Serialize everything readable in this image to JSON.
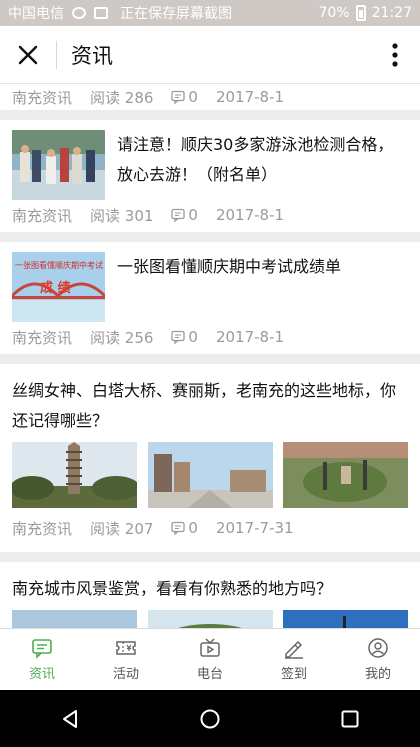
{
  "status_bar": {
    "carrier": "中国电信",
    "notice": "正在保存屏幕截图",
    "battery": "70%",
    "time": "21:27"
  },
  "header": {
    "title": "资讯"
  },
  "articles": [
    {
      "source": "南充资讯",
      "reads": "阅读 286",
      "comments": "0",
      "date": "2017-8-1"
    },
    {
      "title": "请注意！顺庆30多家游泳池检测合格，放心去游！（附名单）",
      "source": "南充资讯",
      "reads": "阅读 301",
      "comments": "0",
      "date": "2017-8-1"
    },
    {
      "title": "一张图看懂顺庆期中考试成绩单",
      "source": "南充资讯",
      "reads": "阅读 256",
      "comments": "0",
      "date": "2017-8-1",
      "thumb_caption": "一张图看懂顺庆期中考试",
      "thumb_word": "成 绩"
    },
    {
      "title": "丝绸女神、白塔大桥、赛丽斯，老南充的这些地标，你还记得哪些？",
      "source": "南充资讯",
      "reads": "阅读 207",
      "comments": "0",
      "date": "2017-7-31"
    },
    {
      "title": "南充城市风景鉴赏，看看有你熟悉的地方吗？"
    }
  ],
  "tabs": [
    {
      "label": "资讯",
      "icon": "news-icon",
      "active": true
    },
    {
      "label": "活动",
      "icon": "ticket-icon",
      "active": false
    },
    {
      "label": "电台",
      "icon": "radio-icon",
      "active": false
    },
    {
      "label": "签到",
      "icon": "signin-icon",
      "active": false
    },
    {
      "label": "我的",
      "icon": "profile-icon",
      "active": false
    }
  ],
  "colors": {
    "accent": "#4caf50",
    "meta_text": "#9b9b9b",
    "background": "#ececec"
  }
}
